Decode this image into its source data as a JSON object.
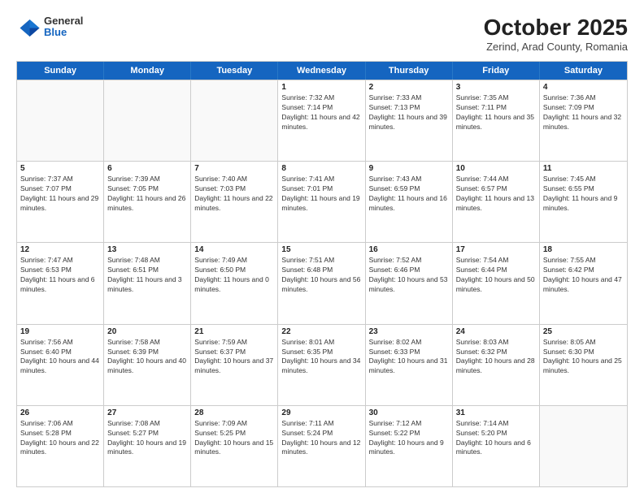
{
  "header": {
    "logo": {
      "line1": "General",
      "line2": "Blue"
    },
    "title": "October 2025",
    "subtitle": "Zerind, Arad County, Romania"
  },
  "weekdays": [
    "Sunday",
    "Monday",
    "Tuesday",
    "Wednesday",
    "Thursday",
    "Friday",
    "Saturday"
  ],
  "rows": [
    [
      {
        "day": "",
        "sunrise": "",
        "sunset": "",
        "daylight": ""
      },
      {
        "day": "",
        "sunrise": "",
        "sunset": "",
        "daylight": ""
      },
      {
        "day": "",
        "sunrise": "",
        "sunset": "",
        "daylight": ""
      },
      {
        "day": "1",
        "sunrise": "Sunrise: 7:32 AM",
        "sunset": "Sunset: 7:14 PM",
        "daylight": "Daylight: 11 hours and 42 minutes."
      },
      {
        "day": "2",
        "sunrise": "Sunrise: 7:33 AM",
        "sunset": "Sunset: 7:13 PM",
        "daylight": "Daylight: 11 hours and 39 minutes."
      },
      {
        "day": "3",
        "sunrise": "Sunrise: 7:35 AM",
        "sunset": "Sunset: 7:11 PM",
        "daylight": "Daylight: 11 hours and 35 minutes."
      },
      {
        "day": "4",
        "sunrise": "Sunrise: 7:36 AM",
        "sunset": "Sunset: 7:09 PM",
        "daylight": "Daylight: 11 hours and 32 minutes."
      }
    ],
    [
      {
        "day": "5",
        "sunrise": "Sunrise: 7:37 AM",
        "sunset": "Sunset: 7:07 PM",
        "daylight": "Daylight: 11 hours and 29 minutes."
      },
      {
        "day": "6",
        "sunrise": "Sunrise: 7:39 AM",
        "sunset": "Sunset: 7:05 PM",
        "daylight": "Daylight: 11 hours and 26 minutes."
      },
      {
        "day": "7",
        "sunrise": "Sunrise: 7:40 AM",
        "sunset": "Sunset: 7:03 PM",
        "daylight": "Daylight: 11 hours and 22 minutes."
      },
      {
        "day": "8",
        "sunrise": "Sunrise: 7:41 AM",
        "sunset": "Sunset: 7:01 PM",
        "daylight": "Daylight: 11 hours and 19 minutes."
      },
      {
        "day": "9",
        "sunrise": "Sunrise: 7:43 AM",
        "sunset": "Sunset: 6:59 PM",
        "daylight": "Daylight: 11 hours and 16 minutes."
      },
      {
        "day": "10",
        "sunrise": "Sunrise: 7:44 AM",
        "sunset": "Sunset: 6:57 PM",
        "daylight": "Daylight: 11 hours and 13 minutes."
      },
      {
        "day": "11",
        "sunrise": "Sunrise: 7:45 AM",
        "sunset": "Sunset: 6:55 PM",
        "daylight": "Daylight: 11 hours and 9 minutes."
      }
    ],
    [
      {
        "day": "12",
        "sunrise": "Sunrise: 7:47 AM",
        "sunset": "Sunset: 6:53 PM",
        "daylight": "Daylight: 11 hours and 6 minutes."
      },
      {
        "day": "13",
        "sunrise": "Sunrise: 7:48 AM",
        "sunset": "Sunset: 6:51 PM",
        "daylight": "Daylight: 11 hours and 3 minutes."
      },
      {
        "day": "14",
        "sunrise": "Sunrise: 7:49 AM",
        "sunset": "Sunset: 6:50 PM",
        "daylight": "Daylight: 11 hours and 0 minutes."
      },
      {
        "day": "15",
        "sunrise": "Sunrise: 7:51 AM",
        "sunset": "Sunset: 6:48 PM",
        "daylight": "Daylight: 10 hours and 56 minutes."
      },
      {
        "day": "16",
        "sunrise": "Sunrise: 7:52 AM",
        "sunset": "Sunset: 6:46 PM",
        "daylight": "Daylight: 10 hours and 53 minutes."
      },
      {
        "day": "17",
        "sunrise": "Sunrise: 7:54 AM",
        "sunset": "Sunset: 6:44 PM",
        "daylight": "Daylight: 10 hours and 50 minutes."
      },
      {
        "day": "18",
        "sunrise": "Sunrise: 7:55 AM",
        "sunset": "Sunset: 6:42 PM",
        "daylight": "Daylight: 10 hours and 47 minutes."
      }
    ],
    [
      {
        "day": "19",
        "sunrise": "Sunrise: 7:56 AM",
        "sunset": "Sunset: 6:40 PM",
        "daylight": "Daylight: 10 hours and 44 minutes."
      },
      {
        "day": "20",
        "sunrise": "Sunrise: 7:58 AM",
        "sunset": "Sunset: 6:39 PM",
        "daylight": "Daylight: 10 hours and 40 minutes."
      },
      {
        "day": "21",
        "sunrise": "Sunrise: 7:59 AM",
        "sunset": "Sunset: 6:37 PM",
        "daylight": "Daylight: 10 hours and 37 minutes."
      },
      {
        "day": "22",
        "sunrise": "Sunrise: 8:01 AM",
        "sunset": "Sunset: 6:35 PM",
        "daylight": "Daylight: 10 hours and 34 minutes."
      },
      {
        "day": "23",
        "sunrise": "Sunrise: 8:02 AM",
        "sunset": "Sunset: 6:33 PM",
        "daylight": "Daylight: 10 hours and 31 minutes."
      },
      {
        "day": "24",
        "sunrise": "Sunrise: 8:03 AM",
        "sunset": "Sunset: 6:32 PM",
        "daylight": "Daylight: 10 hours and 28 minutes."
      },
      {
        "day": "25",
        "sunrise": "Sunrise: 8:05 AM",
        "sunset": "Sunset: 6:30 PM",
        "daylight": "Daylight: 10 hours and 25 minutes."
      }
    ],
    [
      {
        "day": "26",
        "sunrise": "Sunrise: 7:06 AM",
        "sunset": "Sunset: 5:28 PM",
        "daylight": "Daylight: 10 hours and 22 minutes."
      },
      {
        "day": "27",
        "sunrise": "Sunrise: 7:08 AM",
        "sunset": "Sunset: 5:27 PM",
        "daylight": "Daylight: 10 hours and 19 minutes."
      },
      {
        "day": "28",
        "sunrise": "Sunrise: 7:09 AM",
        "sunset": "Sunset: 5:25 PM",
        "daylight": "Daylight: 10 hours and 15 minutes."
      },
      {
        "day": "29",
        "sunrise": "Sunrise: 7:11 AM",
        "sunset": "Sunset: 5:24 PM",
        "daylight": "Daylight: 10 hours and 12 minutes."
      },
      {
        "day": "30",
        "sunrise": "Sunrise: 7:12 AM",
        "sunset": "Sunset: 5:22 PM",
        "daylight": "Daylight: 10 hours and 9 minutes."
      },
      {
        "day": "31",
        "sunrise": "Sunrise: 7:14 AM",
        "sunset": "Sunset: 5:20 PM",
        "daylight": "Daylight: 10 hours and 6 minutes."
      },
      {
        "day": "",
        "sunrise": "",
        "sunset": "",
        "daylight": ""
      }
    ]
  ]
}
